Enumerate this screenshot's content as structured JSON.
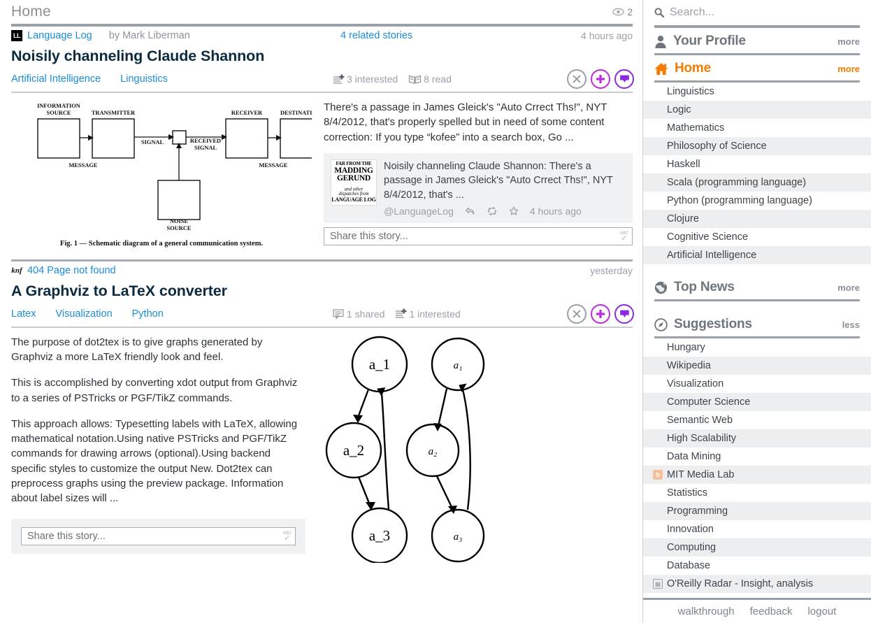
{
  "header": {
    "title": "Home",
    "unread_count": "2",
    "eye_icon": "eye-icon"
  },
  "stories": [
    {
      "feed_name": "Language Log",
      "favicon_text": "LL",
      "byline": "by Mark Liberman",
      "related": "4 related stories",
      "time": "4 hours ago",
      "title": "Noisily channeling Claude Shannon",
      "tags": [
        "Artificial Intelligence",
        "Linguistics"
      ],
      "counters": [
        {
          "icon": "interested-icon",
          "label": "3 interested"
        },
        {
          "icon": "read-book-icon",
          "label": "8 read"
        }
      ],
      "actions": [
        {
          "name": "hide-story-button",
          "icon": "x-circle-icon"
        },
        {
          "name": "focus-story-button",
          "icon": "plus-circle-icon"
        },
        {
          "name": "save-story-button",
          "icon": "save-tag-icon"
        }
      ],
      "excerpt": "There's a passage in James Gleick's \"Auto Crrect Ths!\", NYT 8/4/2012, that's properly spelled but in need of some content correction: If you type “kofee” into a search box, Go ...",
      "image": {
        "alt": "Shannon schematic diagram of a general communication system",
        "caption": "Fig. 1 — Schematic diagram of a general communication system.",
        "labels": {
          "information_source": "INFORMATION\nSOURCE",
          "transmitter": "TRANSMITTER",
          "receiver": "RECEIVER",
          "destination": "DESTINATION",
          "signal": "SIGNAL",
          "received_signal": "RECEIVED\nSIGNAL",
          "message_left": "MESSAGE",
          "message_right": "MESSAGE",
          "noise_source": "NOISE\nSOURCE"
        }
      },
      "tweet": {
        "thumb_lines": [
          "FAR FROM THE",
          "MADDING",
          "GERUND",
          "and other dispatches from",
          "LANGUAGE LOG"
        ],
        "text": "Noisily channeling Claude Shannon: There's a passage in James Gleick's \"Auto Crrect Ths!\", NYT 8/4/2012, that's ...",
        "handle": "@LanguageLog",
        "reply_icon": "reply-arrow-icon",
        "retweet_icon": "retweet-icon",
        "favorite_icon": "star-icon",
        "time": "4 hours ago"
      },
      "share_placeholder": "Share this story...",
      "spellcheck_icon": "abc-check-icon"
    },
    {
      "feed_name": "404 Page not found",
      "favicon_text": "knf",
      "byline": "",
      "related": "",
      "time": "yesterday",
      "title": "A Graphviz to LaTeX converter",
      "tags": [
        "Latex",
        "Visualization",
        "Python"
      ],
      "counters": [
        {
          "icon": "shared-comment-icon",
          "label": "1 shared"
        },
        {
          "icon": "interested-icon",
          "label": "1 interested"
        }
      ],
      "actions": [
        {
          "name": "hide-story-button",
          "icon": "x-circle-icon"
        },
        {
          "name": "focus-story-button",
          "icon": "plus-circle-icon"
        },
        {
          "name": "save-story-button",
          "icon": "save-tag-icon"
        }
      ],
      "paragraphs": [
        "The purpose of dot2tex is to give graphs generated by Graphviz a more LaTeX friendly look and feel.",
        "This is accomplished by converting xdot output from Graphviz to a series of PSTricks or PGF/TikZ commands.",
        "This approach allows: Typesetting labels with LaTeX, allowing mathematical notation.Using native PSTricks and PGF/TikZ commands for drawing arrows (optional).Using backend specific styles to customize the output New. Dot2tex can preprocess graphs using the preview package. Information about label sizes will ..."
      ],
      "graph": {
        "left_nodes": [
          "a_1",
          "a_2",
          "a_3"
        ],
        "right_nodes": [
          "a₁",
          "a₂",
          "a₃"
        ]
      },
      "share_placeholder": "Share this story...",
      "spellcheck_icon": "abc-check-icon"
    }
  ],
  "sidebar": {
    "search": {
      "placeholder": "Search...",
      "icon": "search-icon"
    },
    "sections": [
      {
        "name": "profile",
        "icon": "person-icon",
        "title": "Your Profile",
        "toggle": "more",
        "active": false,
        "items": []
      },
      {
        "name": "home",
        "icon": "house-icon",
        "title": "Home",
        "toggle": "more",
        "active": true,
        "items": [
          {
            "label": "Linguistics",
            "icon": ""
          },
          {
            "label": "Logic",
            "icon": ""
          },
          {
            "label": "Mathematics",
            "icon": ""
          },
          {
            "label": "Philosophy of Science",
            "icon": ""
          },
          {
            "label": "Haskell",
            "icon": ""
          },
          {
            "label": "Scala (programming language)",
            "icon": ""
          },
          {
            "label": "Python (programming language)",
            "icon": ""
          },
          {
            "label": "Clojure",
            "icon": ""
          },
          {
            "label": "Cognitive Science",
            "icon": ""
          },
          {
            "label": "Artificial Intelligence",
            "icon": ""
          }
        ]
      },
      {
        "name": "top-news",
        "icon": "globe-icon",
        "title": "Top News",
        "toggle": "more",
        "active": false,
        "items": []
      },
      {
        "name": "suggestions",
        "icon": "compass-icon",
        "title": "Suggestions",
        "toggle": "less",
        "active": false,
        "items": [
          {
            "label": "Hungary",
            "icon": ""
          },
          {
            "label": "Wikipedia",
            "icon": ""
          },
          {
            "label": "Visualization",
            "icon": ""
          },
          {
            "label": "Computer Science",
            "icon": ""
          },
          {
            "label": "Semantic Web",
            "icon": ""
          },
          {
            "label": "High Scalability",
            "icon": ""
          },
          {
            "label": "Data Mining",
            "icon": ""
          },
          {
            "label": "MIT Media Lab",
            "icon": "blogger-icon"
          },
          {
            "label": "Statistics",
            "icon": ""
          },
          {
            "label": "Programming",
            "icon": ""
          },
          {
            "label": "Innovation",
            "icon": ""
          },
          {
            "label": "Computing",
            "icon": ""
          },
          {
            "label": "Database",
            "icon": ""
          },
          {
            "label": "O'Reilly Radar - Insight, analysis",
            "icon": "feed-icon"
          }
        ]
      }
    ],
    "footer": {
      "links": [
        "walkthrough",
        "feedback",
        "logout"
      ]
    }
  },
  "colors": {
    "link": "#1a8cd8",
    "accent_orange": "#f57c00",
    "muted": "#9aa0a8",
    "purple": "#8a2be2",
    "magenta": "#c02ae0",
    "title": "#0b2b40"
  }
}
